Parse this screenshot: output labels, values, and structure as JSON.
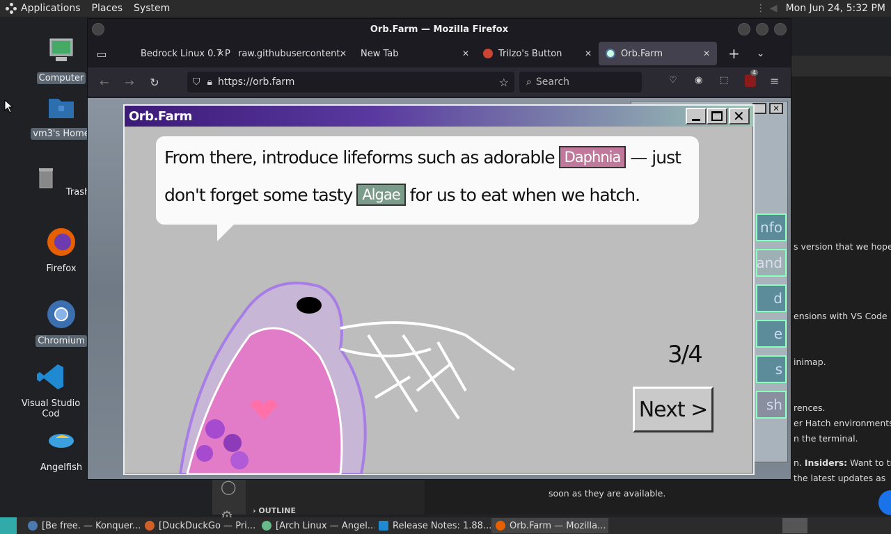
{
  "top_panel": {
    "menus": [
      "Applications",
      "Places",
      "System"
    ],
    "clock": "Mon Jun 24,  5:32 PM"
  },
  "desktop": {
    "icons": [
      {
        "label": "Computer",
        "icon": "computer-icon"
      },
      {
        "label": "vm3's Home",
        "icon": "home-folder-icon"
      },
      {
        "label": "Trash",
        "icon": "trash-icon"
      },
      {
        "label": "Firefox",
        "icon": "firefox-icon"
      },
      {
        "label": "Chromium",
        "icon": "chromium-icon"
      },
      {
        "label": "Visual Studio Cod",
        "icon": "vscode-icon"
      },
      {
        "label": "Angelfish",
        "icon": "angelfish-icon"
      }
    ]
  },
  "background_doc": {
    "outline_label": "OUTLINE",
    "lines": [
      "s version that we hope",
      "ensions with VS Code",
      "inimap.",
      "rences.",
      "er Hatch environments.",
      "n the terminal.",
      "soon as they are available."
    ],
    "insiders_bold": "Insiders:",
    "insiders_prefix": "n. ",
    "insiders_text": " Want to try",
    "updates_text": "the latest updates as"
  },
  "firefox": {
    "window_title": "Orb.Farm — Mozilla Firefox",
    "tabs": [
      {
        "label": "Bedrock Linux 0.7 P",
        "active": false
      },
      {
        "label": "raw.githubusercontent.",
        "active": false
      },
      {
        "label": "New Tab",
        "active": false
      },
      {
        "label": "Trilzo's Button",
        "active": false
      },
      {
        "label": "Orb.Farm",
        "active": true
      }
    ],
    "url": "https://orb.farm",
    "search_placeholder": "Search",
    "extension_badge": "4"
  },
  "orb_window": {
    "title": "Orb.Farm",
    "line1_before": "From there, introduce lifeforms such as adorable",
    "line1_chip": "Daphnia",
    "line1_after": "— just",
    "line2_before": "don't forget some tasty",
    "line2_chip": "Algae",
    "line2_after": "for us to eat when we hatch.",
    "counter": "3/4",
    "next_label": "Next >"
  },
  "behind_buttons": [
    "nfo",
    "and",
    "d",
    "e",
    "s",
    "sh"
  ],
  "taskbar": {
    "tasks": [
      {
        "label": "[Be free. — Konquer...",
        "active": false
      },
      {
        "label": "[DuckDuckGo — Pri...",
        "active": false
      },
      {
        "label": "[Arch Linux — Angel...",
        "active": false
      },
      {
        "label": "Release Notes: 1.88....",
        "active": false
      },
      {
        "label": "Orb.Farm — Mozilla...",
        "active": true
      }
    ]
  },
  "colors": {
    "daphnia_chip": "#c0789b",
    "algae_chip": "#7b9c8a",
    "orb_title_start": "#3c1a78",
    "orb_title_end": "#9cc6b4"
  }
}
